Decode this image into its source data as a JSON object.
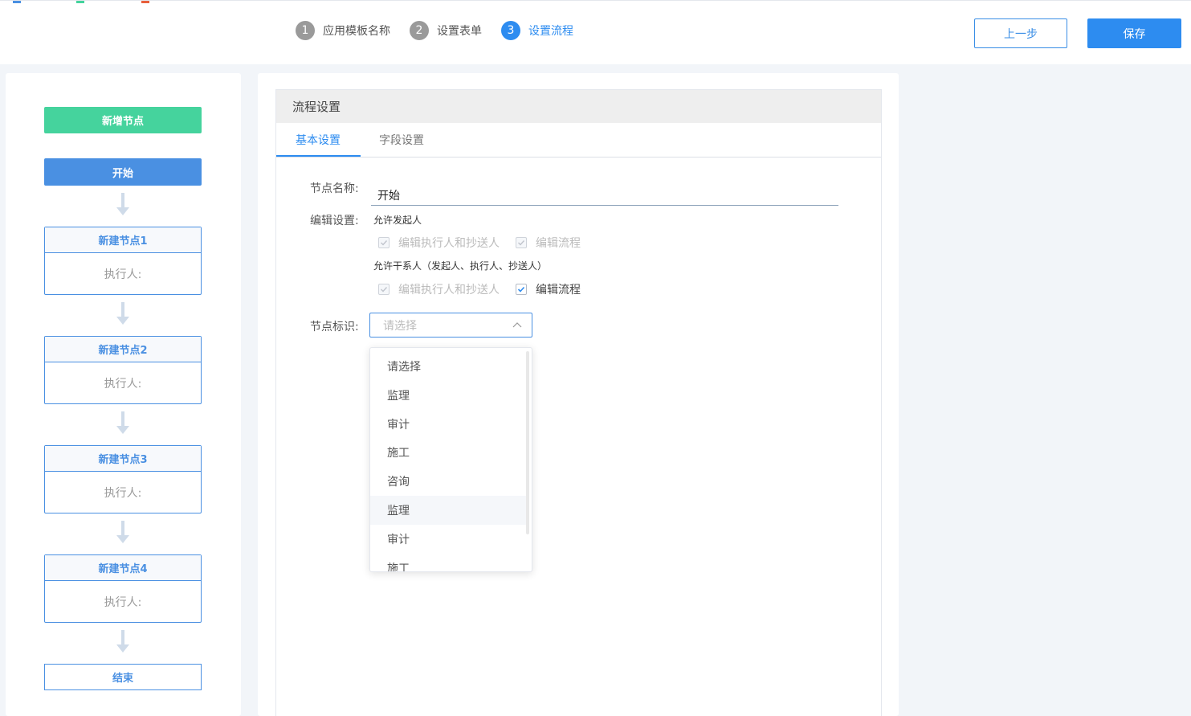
{
  "header": {
    "steps": [
      {
        "num": "1",
        "label": "应用模板名称"
      },
      {
        "num": "2",
        "label": "设置表单"
      },
      {
        "num": "3",
        "label": "设置流程"
      }
    ],
    "prev_label": "上一步",
    "save_label": "保存"
  },
  "flow": {
    "add_node_label": "新增节点",
    "start_label": "开始",
    "nodes": [
      {
        "title": "新建节点1",
        "executor": "执行人:"
      },
      {
        "title": "新建节点2",
        "executor": "执行人:"
      },
      {
        "title": "新建节点3",
        "executor": "执行人:"
      },
      {
        "title": "新建节点4",
        "executor": "执行人:"
      }
    ],
    "end_label": "结束"
  },
  "settings": {
    "title": "流程设置",
    "tabs": [
      "基本设置",
      "字段设置"
    ],
    "node_name_label": "节点名称:",
    "node_name_value": "开始",
    "edit_settings_label": "编辑设置:",
    "allow_initiator": "允许发起人",
    "allow_stakeholders": "允许干系人（发起人、执行人、抄送人）",
    "opt_edit_exec_cc": "编辑执行人和抄送人",
    "opt_edit_flow": "编辑流程",
    "node_tag_label": "节点标识:",
    "select_placeholder": "请选择",
    "options": [
      "请选择",
      "监理",
      "审计",
      "施工",
      "咨询",
      "监理",
      "审计",
      "施工"
    ]
  },
  "colors": {
    "primary": "#2d8cf0",
    "green": "#45d39d",
    "node_blue": "#4a90e2"
  }
}
